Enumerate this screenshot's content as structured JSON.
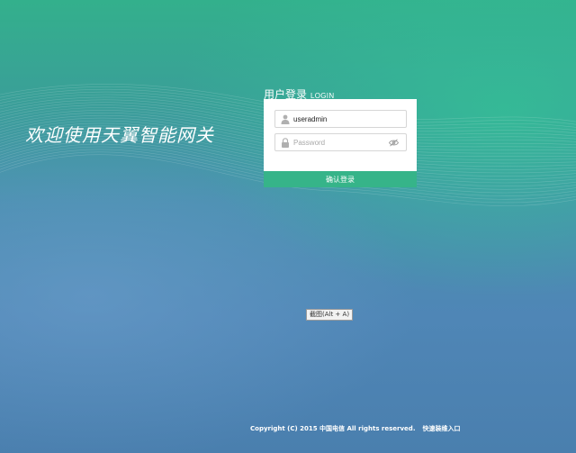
{
  "page": {
    "welcome_text": "欢迎使用天翼智能网关"
  },
  "login": {
    "title_cn": "用户登录",
    "title_en": "LOGIN",
    "username": {
      "value": "useradmin",
      "icon": "user-icon"
    },
    "password": {
      "placeholder": "Password",
      "icon": "lock-icon",
      "toggle_icon": "eye-hidden-icon"
    },
    "submit_label": "确认登录"
  },
  "tooltip": {
    "text": "截图(Alt + A)"
  },
  "footer": {
    "copyright": "Copyright (C) 2015 中国电信 All rights reserved.",
    "quick_install_link": "快速装维入口"
  },
  "colors": {
    "accent": "#36b489",
    "background_top": "#33b08c",
    "background_bottom": "#4a7fae",
    "card": "#ffffff"
  }
}
